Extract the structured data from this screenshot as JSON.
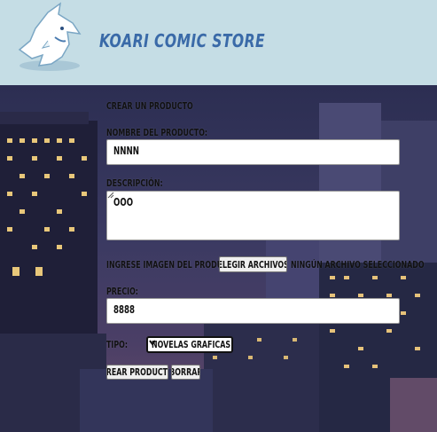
{
  "header": {
    "store_name": "KOARI COMIC STORE",
    "logo_icon": "shark-logo-icon"
  },
  "form": {
    "heading": "CREAR UN PRODUCTO",
    "name_label": "NOMBRE DEL PRODUCTO:",
    "name_value": "NNNN",
    "description_label": "DESCRIPCIÓN:",
    "description_value": "OOO",
    "image_label": "INGRESE IMAGEN DEL PRODUCTO:",
    "file_button_label": "ELEGIR ARCHIVOS",
    "file_status": "NINGÚN ARCHIVO SELECCIONADO",
    "price_label": "PRECIO:",
    "price_value": "8888",
    "category_label": "TIPO:",
    "category_selected": "NOVELAS GRAFICAS",
    "create_button_label": "CREAR PRODUCTO",
    "reset_button_label": "BORRAR"
  },
  "colors": {
    "header_bg": "#c5dde5",
    "brand_text": "#3a6aa8"
  }
}
